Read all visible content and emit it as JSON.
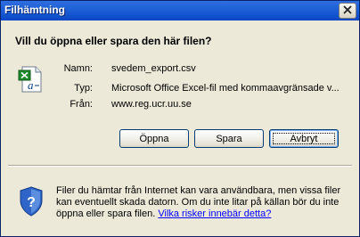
{
  "window": {
    "title": "Filhämtning"
  },
  "dialog": {
    "question": "Vill du öppna eller spara den här filen?",
    "file": {
      "name_label": "Namn:",
      "name_value": "svedem_export.csv",
      "type_label": "Typ:",
      "type_value": "Microsoft Office Excel-fil med kommaavgränsade v...",
      "from_label": "Från:",
      "from_value": "www.reg.ucr.uu.se"
    },
    "buttons": {
      "open_label": "Öppna",
      "save_label": "Spara",
      "cancel_label": "Avbryt"
    },
    "warning": {
      "text": "Filer du hämtar från Internet kan vara användbara, men vissa filer kan eventuellt skada datorn. Om du inte litar på källan bör du inte öppna eller spara filen. ",
      "link": "Vilka risker innebär detta?"
    }
  },
  "icons": {
    "title_close": "close-icon",
    "file": "excel-file-icon",
    "warning": "security-shield-icon"
  }
}
